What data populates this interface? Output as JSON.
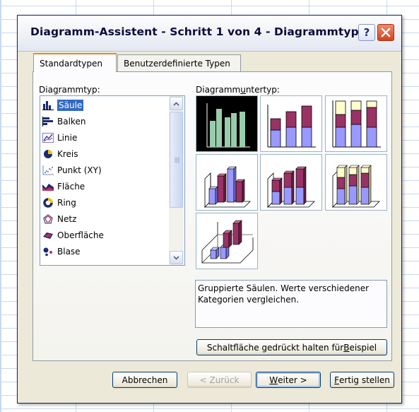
{
  "dialog": {
    "title": "Diagramm-Assistent - Schritt 1 von 4 - Diagrammtyp",
    "help_label": "?",
    "close_label": "✕"
  },
  "tabs": [
    {
      "label": "Standardtypen",
      "active": true
    },
    {
      "label": "Benutzerdefinierte Typen",
      "active": false
    }
  ],
  "chart_type_list": {
    "label": "Diagrammtyp:",
    "items": [
      {
        "label": "Säule",
        "icon": "column-chart-icon",
        "selected": true
      },
      {
        "label": "Balken",
        "icon": "bar-chart-icon",
        "selected": false
      },
      {
        "label": "Linie",
        "icon": "line-chart-icon",
        "selected": false
      },
      {
        "label": "Kreis",
        "icon": "pie-chart-icon",
        "selected": false
      },
      {
        "label": "Punkt (XY)",
        "icon": "scatter-chart-icon",
        "selected": false
      },
      {
        "label": "Fläche",
        "icon": "area-chart-icon",
        "selected": false
      },
      {
        "label": "Ring",
        "icon": "doughnut-chart-icon",
        "selected": false
      },
      {
        "label": "Netz",
        "icon": "radar-chart-icon",
        "selected": false
      },
      {
        "label": "Oberfläche",
        "icon": "surface-chart-icon",
        "selected": false
      },
      {
        "label": "Blase",
        "icon": "bubble-chart-icon",
        "selected": false
      }
    ]
  },
  "subtypes": {
    "label": "Diagrammuntertyp:",
    "items": [
      {
        "name": "clustered-column",
        "selected": true
      },
      {
        "name": "stacked-column",
        "selected": false
      },
      {
        "name": "100-stacked-column",
        "selected": false
      },
      {
        "name": "3d-clustered-column",
        "selected": false
      },
      {
        "name": "3d-stacked-column",
        "selected": false
      },
      {
        "name": "3d-100-stacked-column",
        "selected": false
      },
      {
        "name": "3d-column",
        "selected": false
      }
    ],
    "description": "Gruppierte Säulen. Werte verschiedener Kategorien vergleichen."
  },
  "buttons": {
    "example": "Schaltfläche gedrückt halten für Beispiel",
    "cancel": "Abbrechen",
    "back": "< Zurück",
    "next": "Weiter >",
    "finish": "Fertig stellen"
  },
  "colors": {
    "selection": "#316ac5",
    "series_blue": "#9999ff",
    "series_purple": "#993366",
    "series_cream": "#ffffcc",
    "selected_bars": "#99ccaa"
  }
}
